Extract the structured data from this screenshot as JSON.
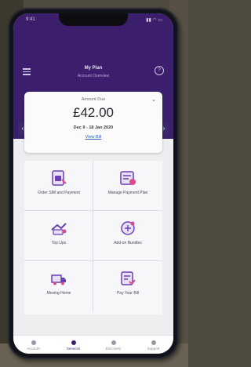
{
  "status_bar": {
    "time": "9:41",
    "icons": "▮▮ ◠ ▭"
  },
  "header": {
    "title": "My Plan",
    "subtitle": "Account Overview"
  },
  "bill": {
    "label": "Amount Due",
    "amount": "£42.00",
    "dates": "Dec 9 - 18 Jan 2020",
    "link": "View Bill"
  },
  "tiles": [
    {
      "label": "Order SIM and Payment",
      "icon": "sim-card-icon"
    },
    {
      "label": "Manage Payment Plan",
      "icon": "payment-plan-icon"
    },
    {
      "label": "Top Ups",
      "icon": "top-up-icon"
    },
    {
      "label": "Add-on Bundles",
      "icon": "bundles-icon"
    },
    {
      "label": "Moving Home",
      "icon": "moving-home-icon"
    },
    {
      "label": "Pay Your Bill",
      "icon": "pay-bill-icon"
    }
  ],
  "tabs": [
    {
      "label": "Account"
    },
    {
      "label": "Services"
    },
    {
      "label": "Discovery"
    },
    {
      "label": "Support"
    }
  ],
  "colors": {
    "brand": "#3b1f6c",
    "link": "#2b63b8",
    "icon_purple": "#6a3fb5"
  }
}
